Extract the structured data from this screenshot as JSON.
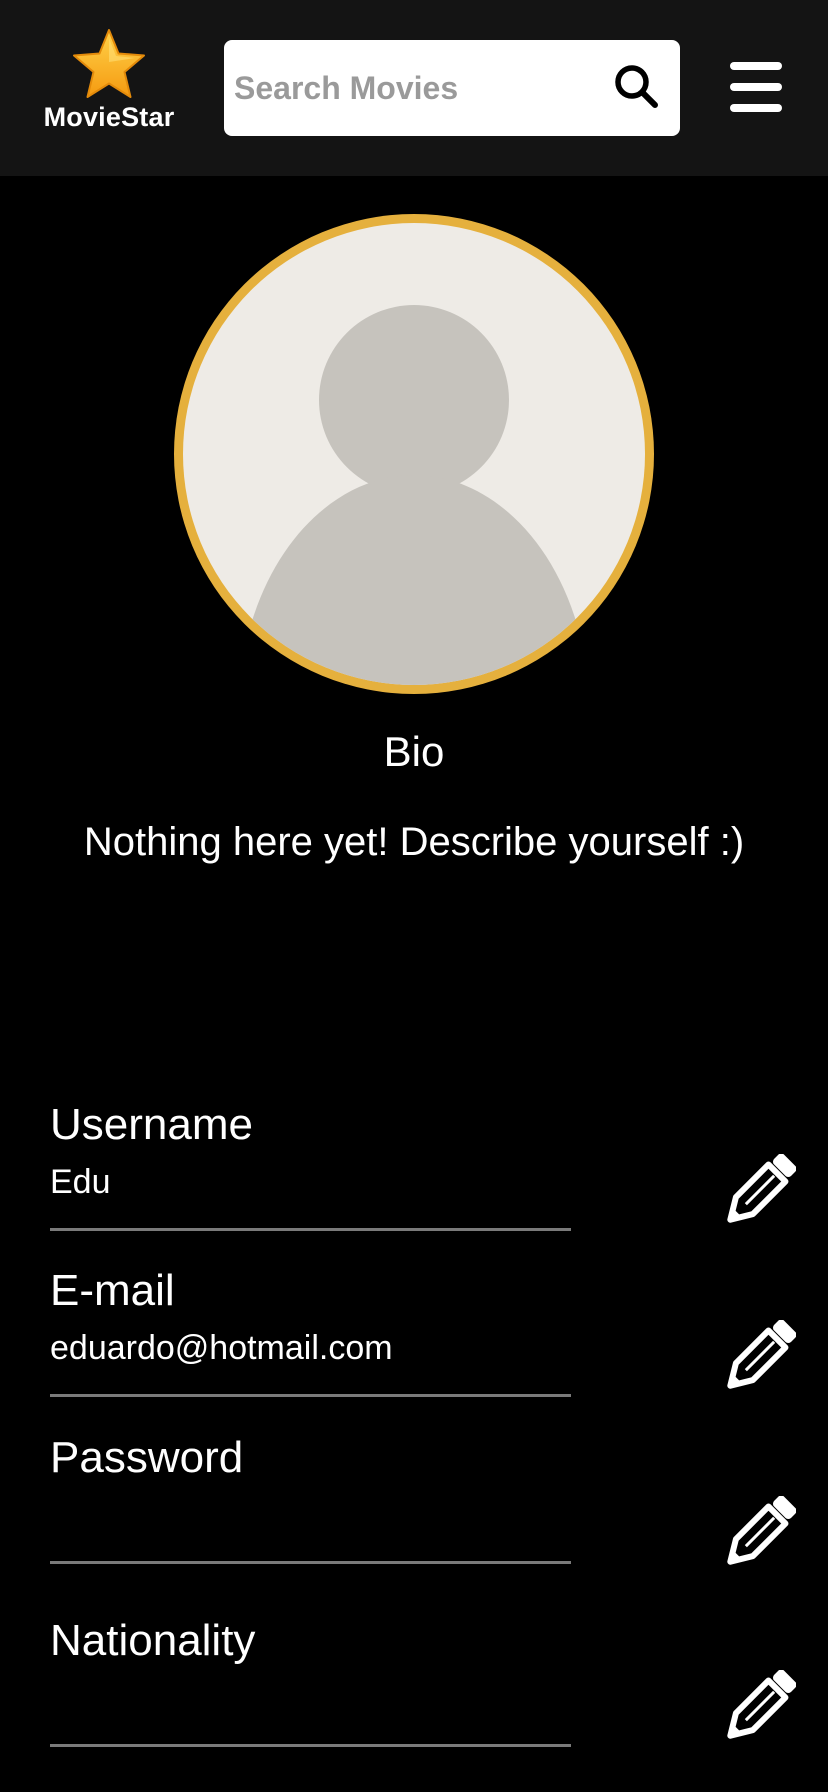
{
  "header": {
    "logo_text": "MovieStar",
    "search": {
      "placeholder": "Search Movies",
      "value": ""
    }
  },
  "profile": {
    "bio_title": "Bio",
    "bio_text": "Nothing here yet! Describe yourself :)"
  },
  "fields": {
    "username": {
      "label": "Username",
      "value": "Edu"
    },
    "email": {
      "label": "E-mail",
      "value": "eduardo@hotmail.com"
    },
    "password": {
      "label": "Password",
      "value": ""
    },
    "nationality": {
      "label": "Nationality",
      "value": ""
    }
  },
  "colors": {
    "accent": "#e5b03d",
    "header_bg": "#141414",
    "page_bg": "#000000",
    "avatar_bg": "#eeebe6",
    "avatar_silhouette": "#c6c3bd"
  },
  "icons": {
    "logo": "star-icon",
    "search": "search-icon",
    "menu": "hamburger-menu-icon",
    "edit": "pencil-icon"
  }
}
